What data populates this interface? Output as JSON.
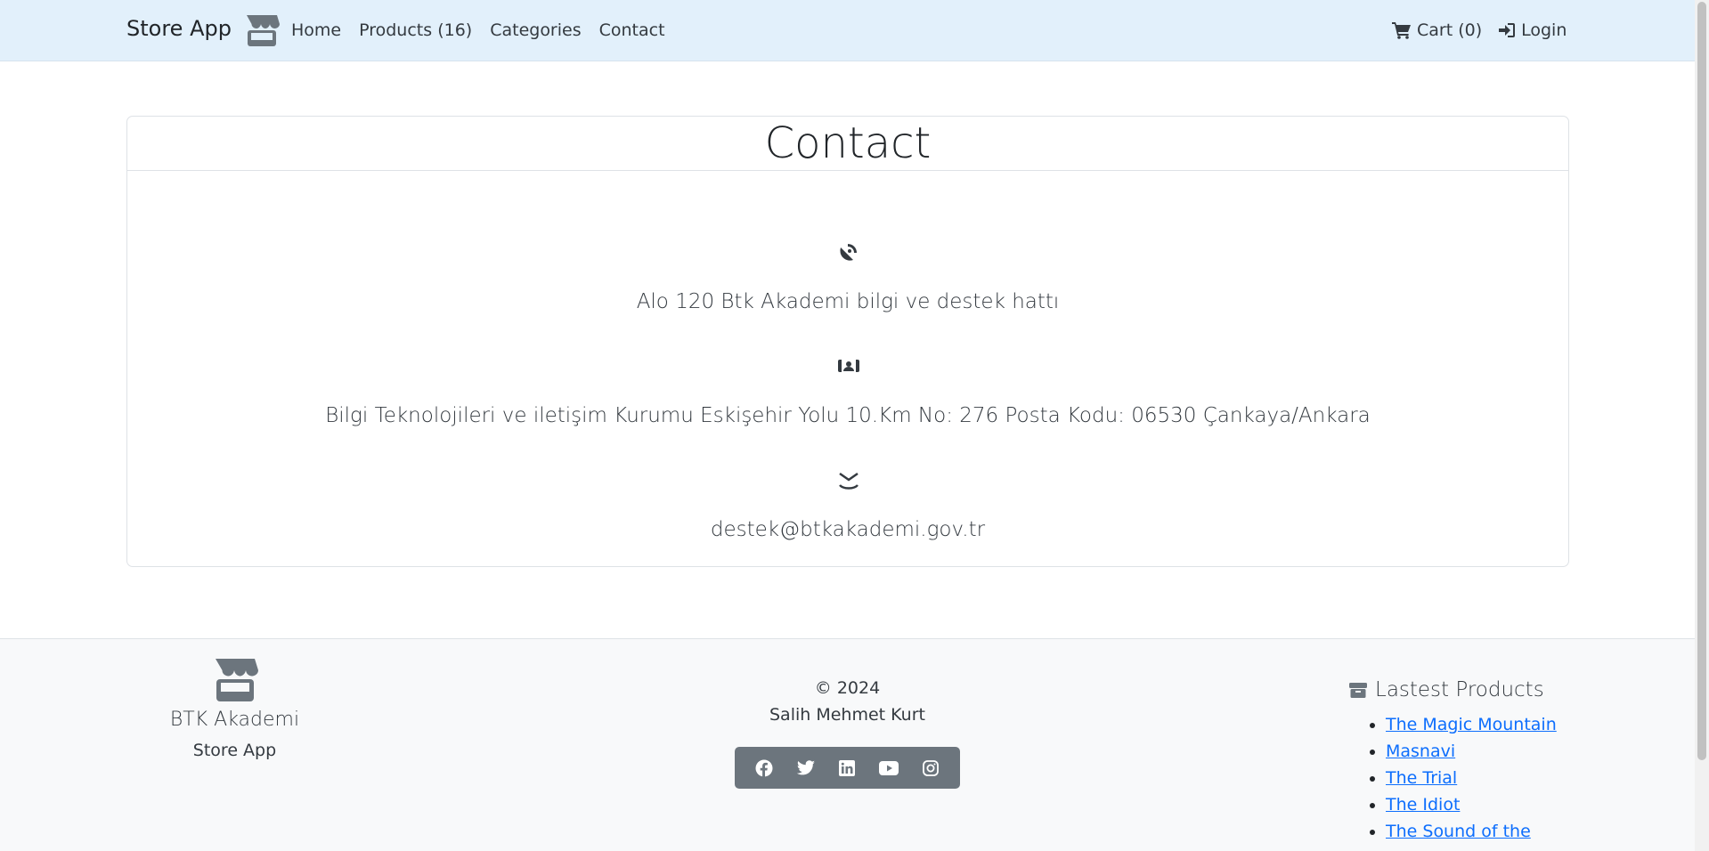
{
  "navbar": {
    "brand": "Store App",
    "links": [
      "Home",
      "Products (16)",
      "Categories",
      "Contact"
    ],
    "cart": "Cart (0)",
    "login": "Login"
  },
  "contact": {
    "title": "Contact",
    "phone": "Alo 120 Btk Akademi bilgi ve destek hattı",
    "address": "Bilgi Teknolojileri ve iletişim Kurumu Eskişehir Yolu 10.Km No: 276 Posta Kodu: 06530 Çankaya/Ankara",
    "email": "destek@btkakademi.gov.tr"
  },
  "footer": {
    "brand": "BTK Akademi",
    "sub": "Store App",
    "copyright": "© 2024",
    "author": "Salih Mehmet Kurt",
    "social": [
      "facebook-icon",
      "twitter-icon",
      "linkedin-icon",
      "youtube-icon",
      "instagram-icon"
    ],
    "latest_title": "Lastest Products",
    "latest_products": [
      "The Magic Mountain",
      "Masnavi",
      "The Trial",
      "The Idiot",
      "The Sound of the"
    ]
  },
  "colors": {
    "navbar_bg": "#e2f0fb",
    "footer_bg": "#f8f9fa",
    "social_bg": "#6c757d",
    "link": "#0d6efd"
  }
}
